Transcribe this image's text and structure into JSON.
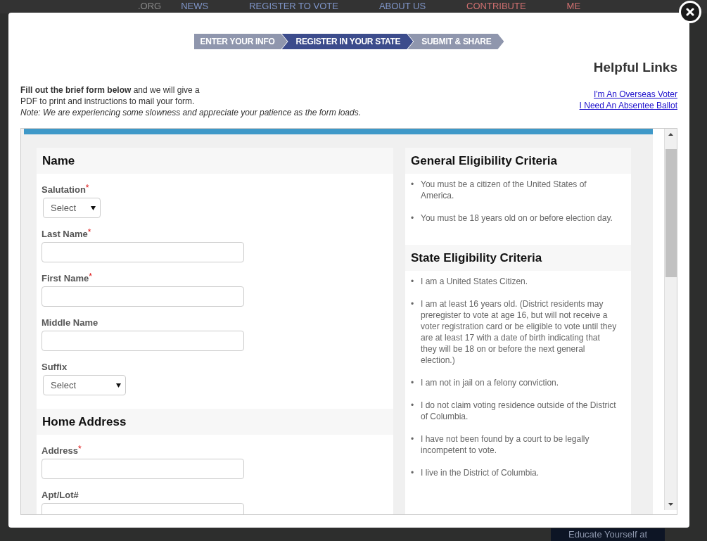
{
  "background_page": {
    "logo_text": ".ORG",
    "nav": [
      {
        "label": "NEWS",
        "kind": "normal"
      },
      {
        "label": "REGISTER TO VOTE",
        "kind": "normal"
      },
      {
        "label": "ABOUT US",
        "kind": "normal"
      },
      {
        "label": "CONTRIBUTE",
        "kind": "accent"
      },
      {
        "label": "ME",
        "kind": "accent"
      }
    ],
    "promo_button": "Educate Yourself at"
  },
  "modal": {
    "steps": [
      {
        "label": "ENTER YOUR INFO",
        "selected": false
      },
      {
        "label": "REGISTER IN YOUR STATE",
        "selected": true
      },
      {
        "label": "SUBMIT & SHARE",
        "selected": false
      }
    ],
    "helpful_links": {
      "title": "Helpful Links",
      "links": [
        "I'm An Overseas Voter",
        "I Need An Absentee Ballot"
      ]
    },
    "intro": [
      "**Fill out the brief form below** and we will give a",
      "PDF to print and instructions to mail your form."
    ],
    "note": "Note: We are experiencing some slowness and appreciate your patience as the form loads.",
    "form_sections": [
      {
        "title": "Name",
        "fields": [
          {
            "label": "Salutation",
            "required_mark": "*",
            "kind": "select",
            "value": "Select"
          },
          {
            "label": "Last Name",
            "required_mark": "*",
            "kind": "text"
          },
          {
            "label": "First Name",
            "required_mark": "*",
            "kind": "text"
          },
          {
            "label": "Middle Name",
            "kind": "text"
          },
          {
            "label": "Suffix",
            "kind": "select",
            "value": "Select"
          }
        ]
      },
      {
        "title": "Home Address",
        "fields": [
          {
            "label": "Address",
            "required_mark": "*",
            "kind": "text"
          },
          {
            "label": "Apt/Lot#",
            "kind": "text"
          }
        ]
      }
    ],
    "criteria": [
      {
        "title": "General Eligibility Criteria",
        "bullet": "•",
        "items": [
          "You must be a citizen of the United States of America.",
          "You must be 18 years old on or before election day."
        ]
      },
      {
        "title": "State Eligibility Criteria",
        "bullet": "•",
        "items": [
          "I am a United States Citizen.",
          "I am at least 16 years old. (District residents may preregister to vote at age 16, but will not receive a voter registration card or be eligible to vote until they are at least 17 with a date of birth indicating that they will be 18 on or before the next general election.)",
          "I am not in jail on a felony conviction.",
          "I do not claim voting residence outside of the District of Columbia.",
          "I have not been found by a court to be legally incompetent to vote.",
          "I live in the District of Columbia."
        ]
      }
    ]
  }
}
